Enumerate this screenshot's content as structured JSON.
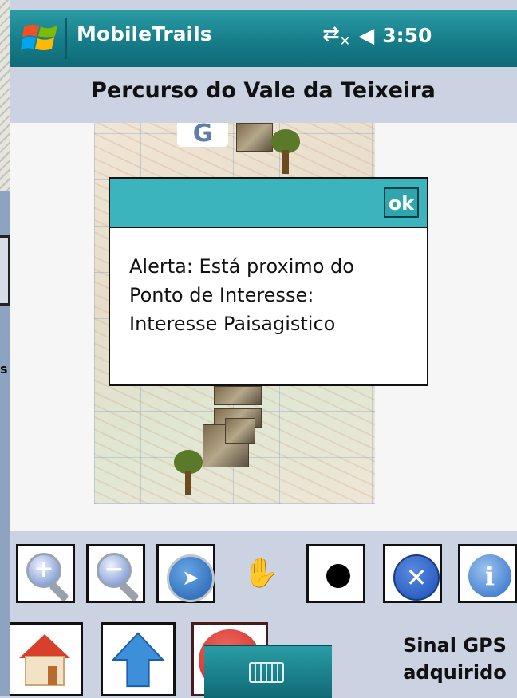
{
  "titlebar": {
    "app_title": "MobileTrails",
    "time": "3:50",
    "icons": [
      "windows-start-icon",
      "network-icon",
      "speaker-icon"
    ],
    "accent_color": "#167d89"
  },
  "route": {
    "title": "Percurso do Vale da Teixeira"
  },
  "map": {
    "google_logo_char": "G"
  },
  "dialog": {
    "ok_label": "ok",
    "message_lines": [
      "Alerta: Está proximo do",
      "Ponto de Interesse:",
      "Interesse Paisagistico"
    ],
    "header_color": "#3bb4bd"
  },
  "toolbar": {
    "zoom_in_sign": "+",
    "zoom_out_sign": "−",
    "tools_icon": [
      "zoom-in-icon",
      "zoom-out-icon",
      "select-pointer-icon",
      "pan-hand-icon",
      "record-dot-icon",
      "settings-tools-icon",
      "info-icon",
      "home-icon",
      "up-arrow-icon",
      "stop-icon",
      "keyboard-icon"
    ],
    "info_glyph": "i",
    "gps_status_line1": "Sinal GPS",
    "gps_status_line2": "adquirido"
  }
}
